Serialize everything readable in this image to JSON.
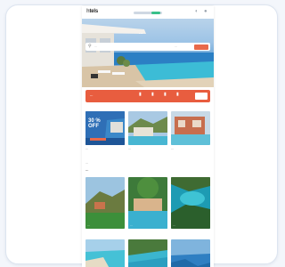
{
  "app": {
    "logo_prefix": "h",
    "logo_name": "tels"
  },
  "header": {
    "icons": [
      "globe-icon",
      "user-icon"
    ]
  },
  "hero": {
    "title": "...",
    "search": {
      "placeholder": "...",
      "dates": "..."
    }
  },
  "promo": {
    "text": "..."
  },
  "offers": [
    {
      "badge": "30 %\nOFF",
      "caption": "..."
    },
    {
      "caption": "..."
    },
    {
      "caption": "..."
    }
  ],
  "sections": {
    "label": "...",
    "title": "..."
  },
  "destinations": [
    {
      "caption": "..."
    },
    {
      "caption": "..."
    },
    {
      "caption": "..."
    }
  ],
  "colors": {
    "accent": "#e85d3f",
    "nav_active": "#39c08a"
  }
}
